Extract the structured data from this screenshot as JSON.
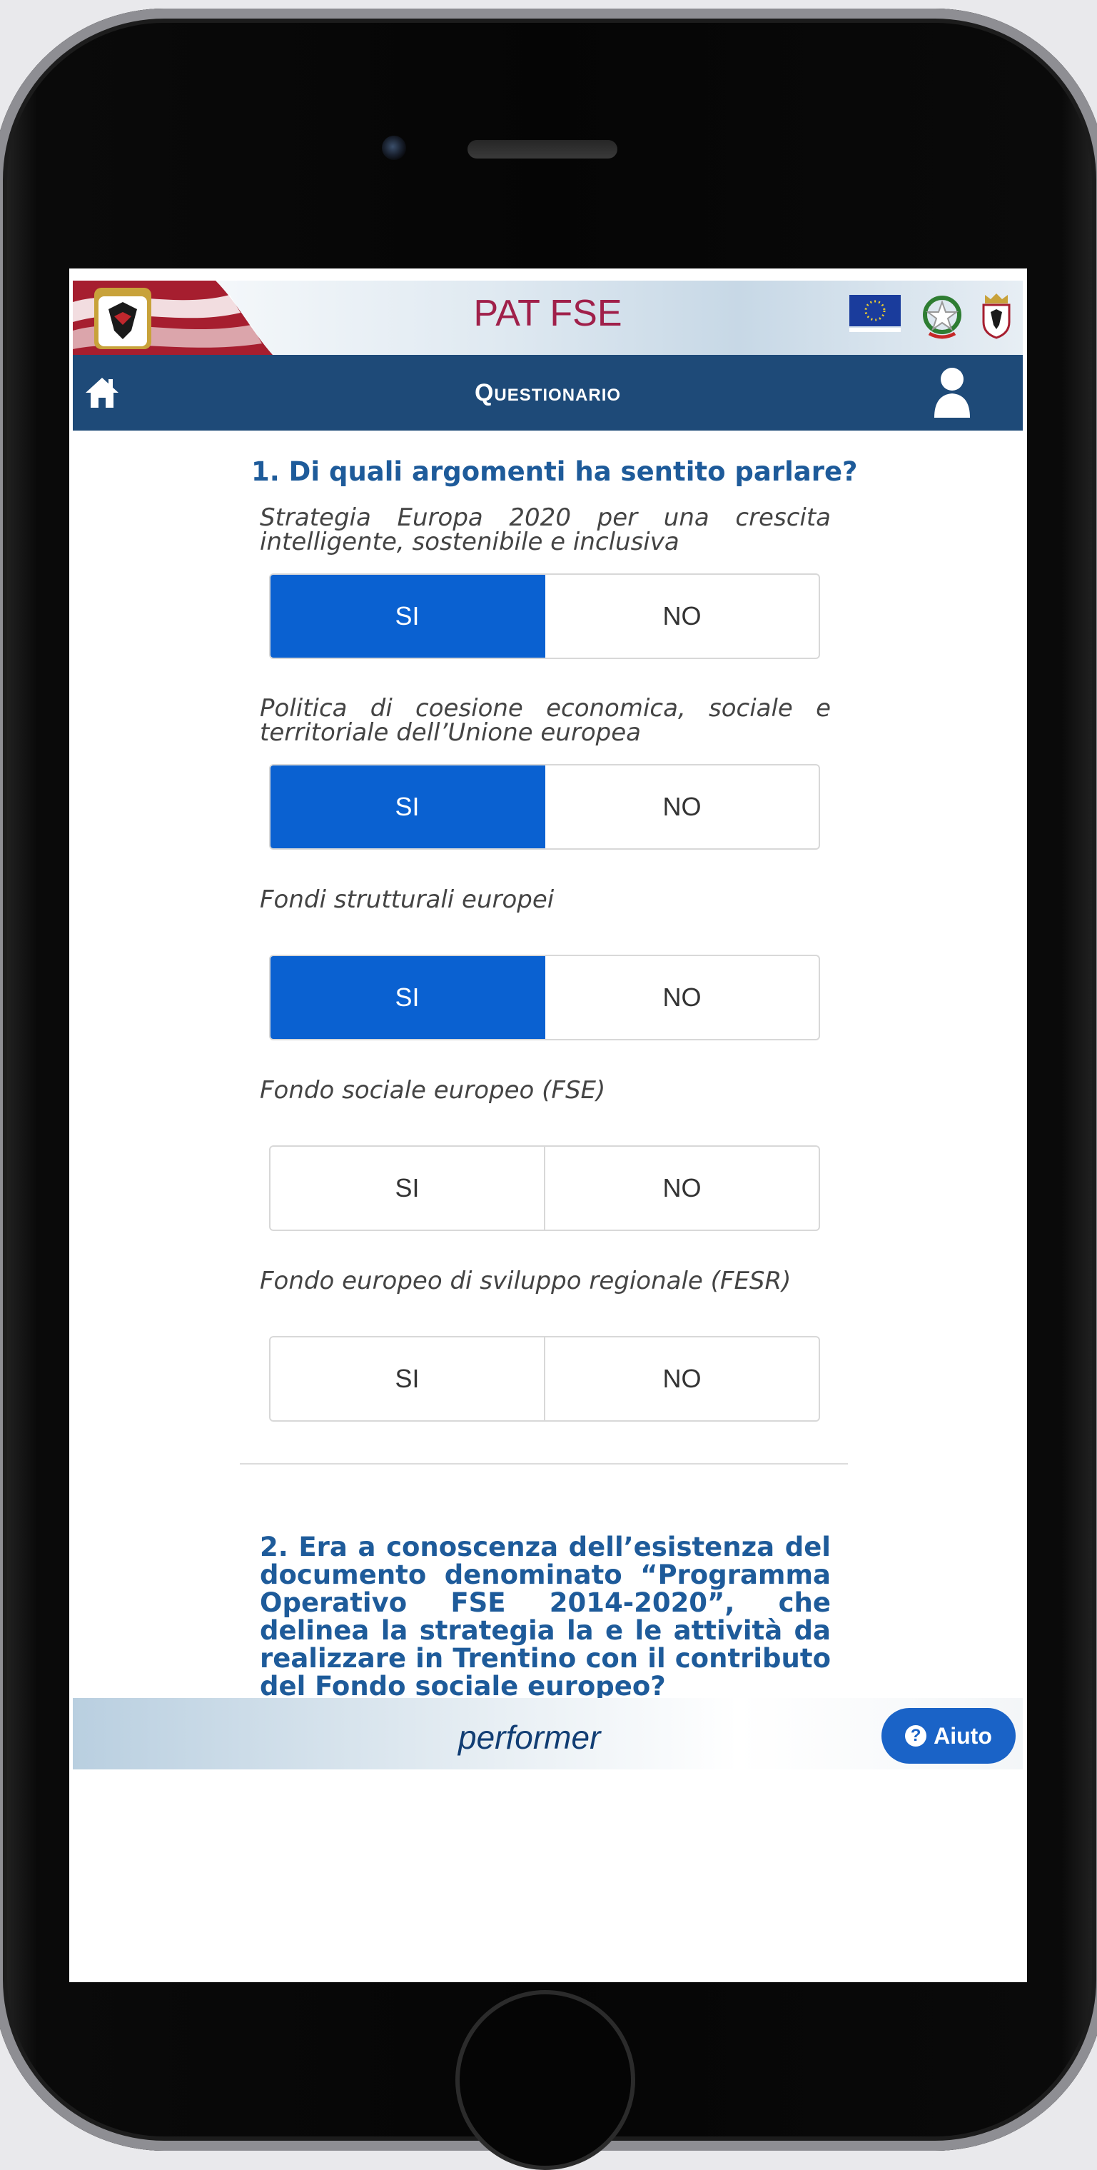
{
  "brand": {
    "title": "PAT FSE"
  },
  "nav": {
    "title": "Questionario",
    "home_icon": "home-icon",
    "user_icon": "user-icon"
  },
  "question1": {
    "title": "1. Di quali argomenti ha sentito parlare?",
    "items": [
      {
        "label": "Strategia Europa 2020 per una crescita intelligente, sostenibile e inclusiva",
        "yes": "SI",
        "no": "NO",
        "selected": "SI"
      },
      {
        "label": "Politica di coesione economica, sociale e territoriale dell’Unione europea",
        "yes": "SI",
        "no": "NO",
        "selected": "SI"
      },
      {
        "label": "Fondi strutturali europei",
        "yes": "SI",
        "no": "NO",
        "selected": "SI"
      },
      {
        "label": "Fondo sociale europeo (FSE)",
        "yes": "SI",
        "no": "NO",
        "selected": ""
      },
      {
        "label": "Fondo europeo di sviluppo regionale (FESR)",
        "yes": "SI",
        "no": "NO",
        "selected": ""
      }
    ]
  },
  "question2": {
    "title": "2. Era a conoscenza dell’esistenza del documento denominato “Programma Operativo FSE 2014-2020”, che delinea la strategia  la e le attività da realizzare in Trentino con il contributo del Fondo sociale europeo?"
  },
  "footer": {
    "brand": "performer",
    "help_label": "Aiuto",
    "help_icon": "question-circle-icon"
  },
  "colors": {
    "accent": "#0a61d1",
    "nav": "#1e4a78",
    "title": "#a0204a",
    "question": "#1e5b9a"
  }
}
